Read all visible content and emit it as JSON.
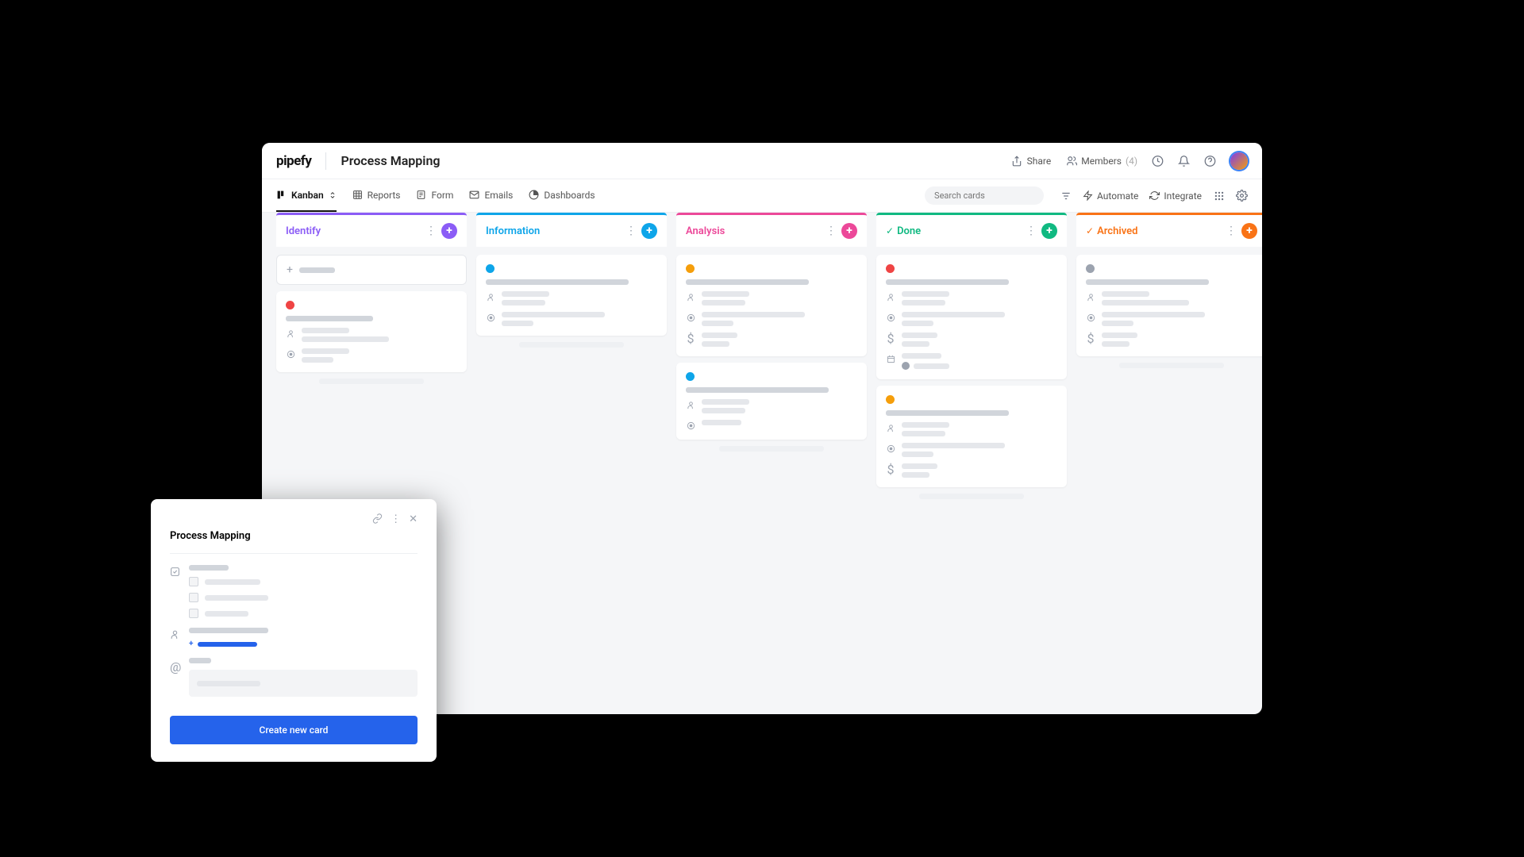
{
  "header": {
    "logo": "pipefy",
    "title": "Process Mapping",
    "share": "Share",
    "members": "Members",
    "members_count": "(4)"
  },
  "toolbar": {
    "kanban": "Kanban",
    "reports": "Reports",
    "form": "Form",
    "emails": "Emails",
    "dashboards": "Dashboards",
    "search_placeholder": "Search cards",
    "automate": "Automate",
    "integrate": "Integrate"
  },
  "columns": [
    {
      "title": "Identify",
      "border": "#8b5cf6",
      "titleColor": "#8b5cf6",
      "addColor": "#8b5cf6",
      "check": false
    },
    {
      "title": "Information",
      "border": "#0ea5e9",
      "titleColor": "#0ea5e9",
      "addColor": "#0ea5e9",
      "check": false
    },
    {
      "title": "Analysis",
      "border": "#ec4899",
      "titleColor": "#ec4899",
      "addColor": "#ec4899",
      "check": false
    },
    {
      "title": "Done",
      "border": "#10b981",
      "titleColor": "#10b981",
      "addColor": "#10b981",
      "check": true
    },
    {
      "title": "Archived",
      "border": "#f97316",
      "titleColor": "#f97316",
      "addColor": "#f97316",
      "check": true
    }
  ],
  "dot_colors": {
    "red": "#ef4444",
    "blue": "#0ea5e9",
    "orange": "#f59e0b",
    "grey": "#9ca3af"
  },
  "modal": {
    "title": "Process Mapping",
    "create_button": "Create new card"
  }
}
